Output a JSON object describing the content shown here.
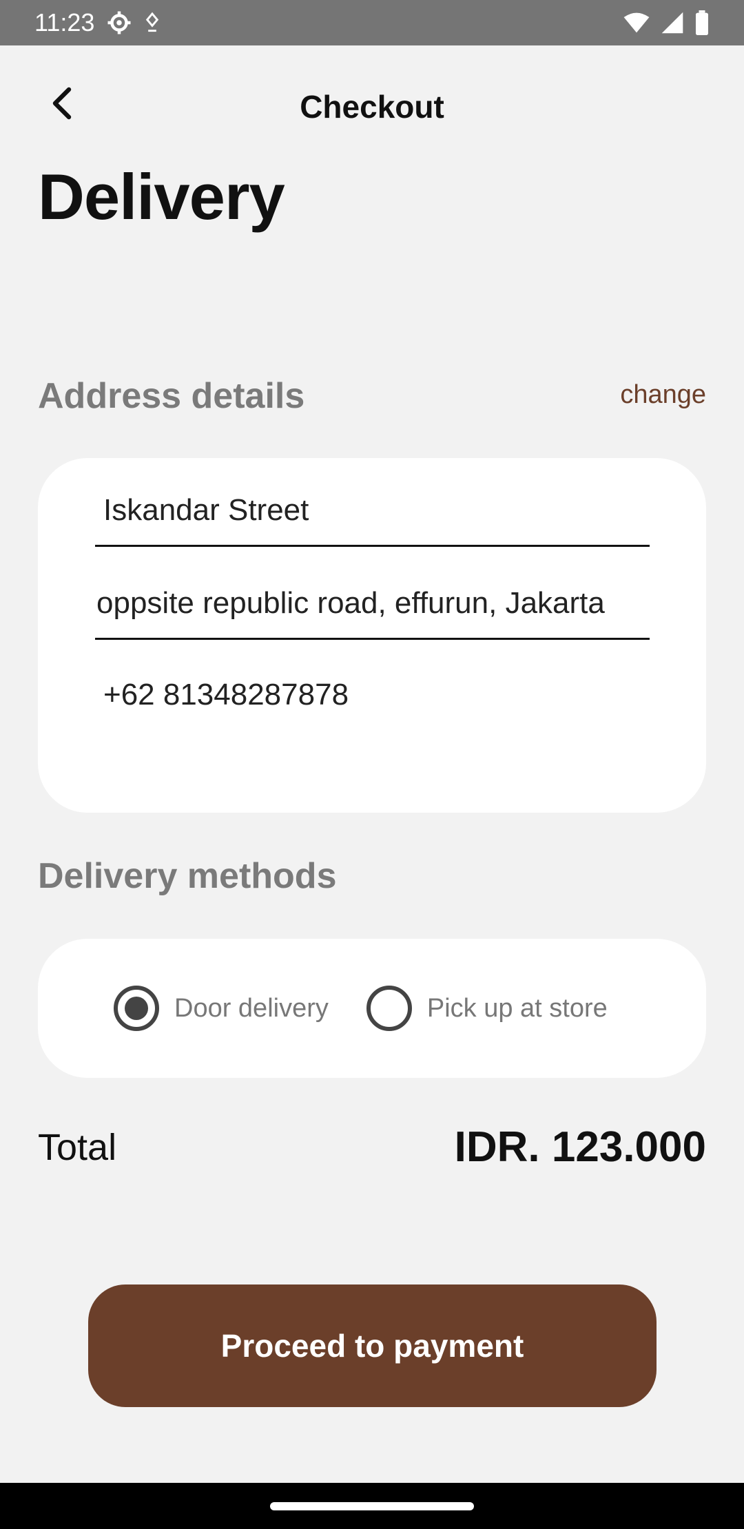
{
  "status_bar": {
    "time": "11:23",
    "icons_left": [
      "gear-icon",
      "location-icon"
    ],
    "icons_right": [
      "wifi-icon",
      "signal-icon",
      "battery-icon"
    ]
  },
  "app_bar": {
    "back_icon": "chevron-left-icon",
    "title": "Checkout"
  },
  "page_title": "Delivery",
  "address": {
    "section_title": "Address details",
    "change_label": "change",
    "street": "Iskandar Street",
    "details": "oppsite republic road, effurun, Jakarta",
    "phone": "+62 81348287878"
  },
  "delivery_methods": {
    "section_title": "Delivery methods",
    "options": [
      {
        "label": "Door delivery",
        "selected": true
      },
      {
        "label": "Pick up at store",
        "selected": false
      }
    ]
  },
  "total": {
    "label": "Total",
    "value": "IDR. 123.000"
  },
  "proceed_button": "Proceed to payment",
  "colors": {
    "accent": "#6b3f2a",
    "background": "#f2f2f2",
    "status_bar": "#757575"
  }
}
